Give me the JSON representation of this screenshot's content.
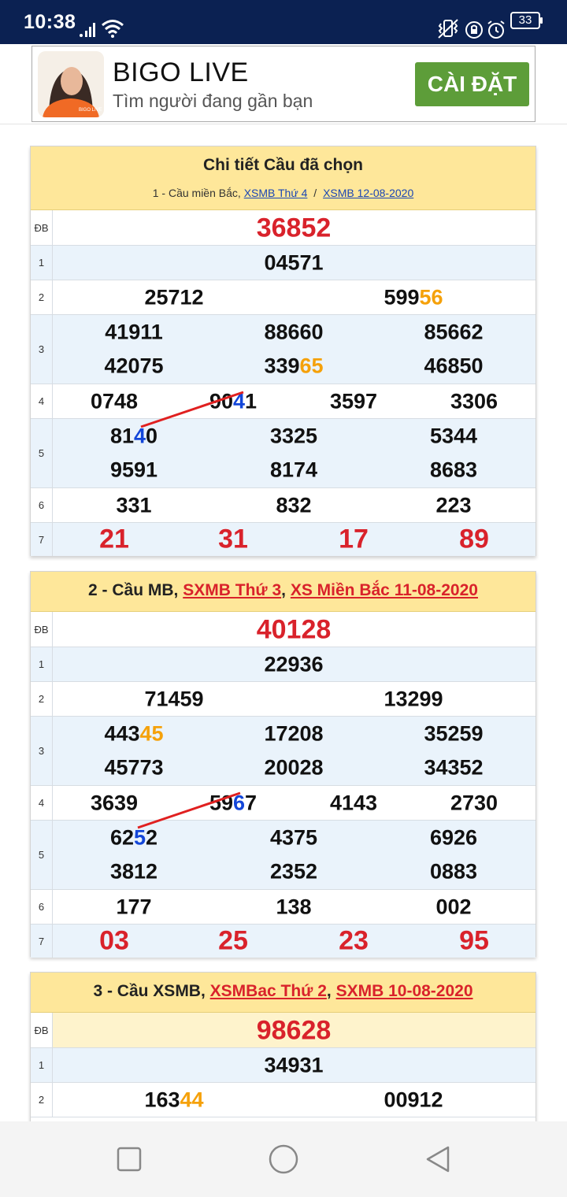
{
  "status": {
    "time": "10:38",
    "battery": "33"
  },
  "ad": {
    "title": "BIGO LIVE",
    "subtitle": "Tìm người đang gần bạn",
    "button": "CÀI ĐẶT",
    "icon_text": "BIGO LIVE"
  },
  "panel1": {
    "title": "Chi tiết Cầu đã chọn",
    "sub_prefix": "1 - Cầu miền Bắc,",
    "link1": "XSMB Thứ 4",
    "sep": "/",
    "link2": "XSMB 12-08-2020",
    "labels": [
      "ĐB",
      "1",
      "2",
      "3",
      "4",
      "5",
      "6",
      "7"
    ],
    "db": "36852",
    "g1": "04571",
    "g2": [
      "25712",
      "599",
      "56"
    ],
    "g3": [
      "41911",
      "88660",
      "85662",
      "42075",
      "339",
      "65",
      "46850"
    ],
    "g4": [
      "0748",
      "90",
      "4",
      "1",
      "3597",
      "3306"
    ],
    "g5": [
      "81",
      "4",
      "0",
      "3325",
      "5344",
      "9591",
      "8174",
      "8683"
    ],
    "g6": [
      "331",
      "832",
      "223"
    ],
    "g7": [
      "21",
      "31",
      "17",
      "89"
    ]
  },
  "panel2": {
    "prefix": "2 - Cầu MB,",
    "link1": "SXMB Thứ 3",
    "sep": ",",
    "link2": "XS Miền Bắc 11-08-2020",
    "labels": [
      "ĐB",
      "1",
      "2",
      "3",
      "4",
      "5",
      "6",
      "7"
    ],
    "db": "40128",
    "g1": "22936",
    "g2": [
      "71459",
      "13299"
    ],
    "g3": [
      "443",
      "45",
      "17208",
      "35259",
      "45773",
      "20028",
      "34352"
    ],
    "g4": [
      "3639",
      "59",
      "6",
      "7",
      "4143",
      "2730"
    ],
    "g5": [
      "62",
      "5",
      "2",
      "4375",
      "6926",
      "3812",
      "2352",
      "0883"
    ],
    "g6": [
      "177",
      "138",
      "002"
    ],
    "g7": [
      "03",
      "25",
      "23",
      "95"
    ]
  },
  "panel3": {
    "prefix": "3 - Cầu XSMB,",
    "link1": "XSMBac Thứ 2",
    "sep": ",",
    "link2": "SXMB 10-08-2020",
    "labels": [
      "ĐB",
      "1",
      "2"
    ],
    "db": "98628",
    "g1": "34931",
    "g2": [
      "163",
      "44",
      "00912"
    ]
  },
  "colors": {
    "status_bar": "#0b2152",
    "header": "#fee79a",
    "red": "#d9222b",
    "orange": "#f5a10a",
    "blue": "#1346d9",
    "install_button": "#5d9d39",
    "row_alt": "#eaf3fb"
  },
  "icons": [
    "signal-icon",
    "wifi-icon",
    "vibrate-icon",
    "rotation-lock-icon",
    "alarm-icon",
    "battery-icon",
    "recent-apps-icon",
    "home-icon",
    "back-icon"
  ]
}
